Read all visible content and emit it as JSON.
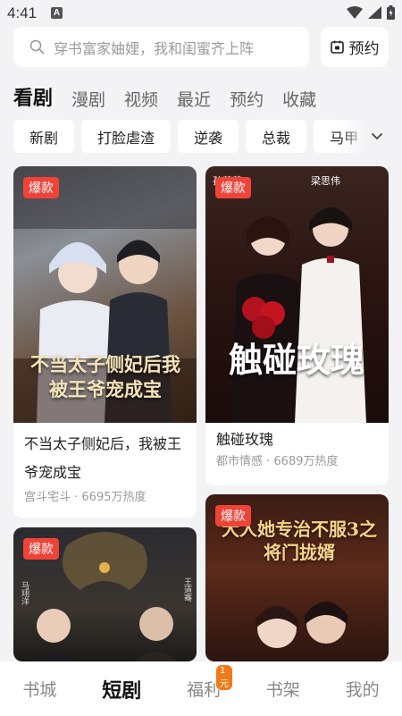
{
  "status_bar": {
    "time": "4:41",
    "notification_letter": "A"
  },
  "search": {
    "placeholder": "穿书富家妯娌，我和闺蜜齐上阵"
  },
  "reserve_button": {
    "label": "预约"
  },
  "tabs": [
    {
      "label": "看剧",
      "active": true
    },
    {
      "label": "漫剧",
      "active": false
    },
    {
      "label": "视频",
      "active": false
    },
    {
      "label": "最近",
      "active": false
    },
    {
      "label": "预约",
      "active": false
    },
    {
      "label": "收藏",
      "active": false
    }
  ],
  "chips": [
    "新剧",
    "打脸虐渣",
    "逆袭",
    "总裁",
    "马甲"
  ],
  "cards": [
    {
      "badge": "爆款",
      "poster_text": "不当太子侧妃后我被王爷宠成宝",
      "title": "不当太子侧妃后，我被王爷宠成宝",
      "meta": "宫斗宅斗 · 6695万热度"
    },
    {
      "badge": "爆款",
      "poster_text": "触碰玫瑰",
      "poster_names": [
        "孙芸芸",
        "梁思伟"
      ],
      "title": "触碰玫瑰",
      "meta": "都市情感 · 6689万热度"
    },
    {
      "badge": "爆款",
      "poster_names": [
        "马翊洋",
        "王道骞"
      ]
    },
    {
      "badge": "爆款",
      "poster_text": "大人她专治不服3之将门拢婿"
    }
  ],
  "bottom_nav": [
    {
      "label": "书城",
      "active": false
    },
    {
      "label": "短剧",
      "active": true
    },
    {
      "label": "福利",
      "active": false,
      "badge": "1元"
    },
    {
      "label": "书架",
      "active": false
    },
    {
      "label": "我的",
      "active": false
    }
  ],
  "colors": {
    "badge_red": "#f04338",
    "welfare_badge": "#f07a19",
    "background": "#f3f3f5"
  }
}
